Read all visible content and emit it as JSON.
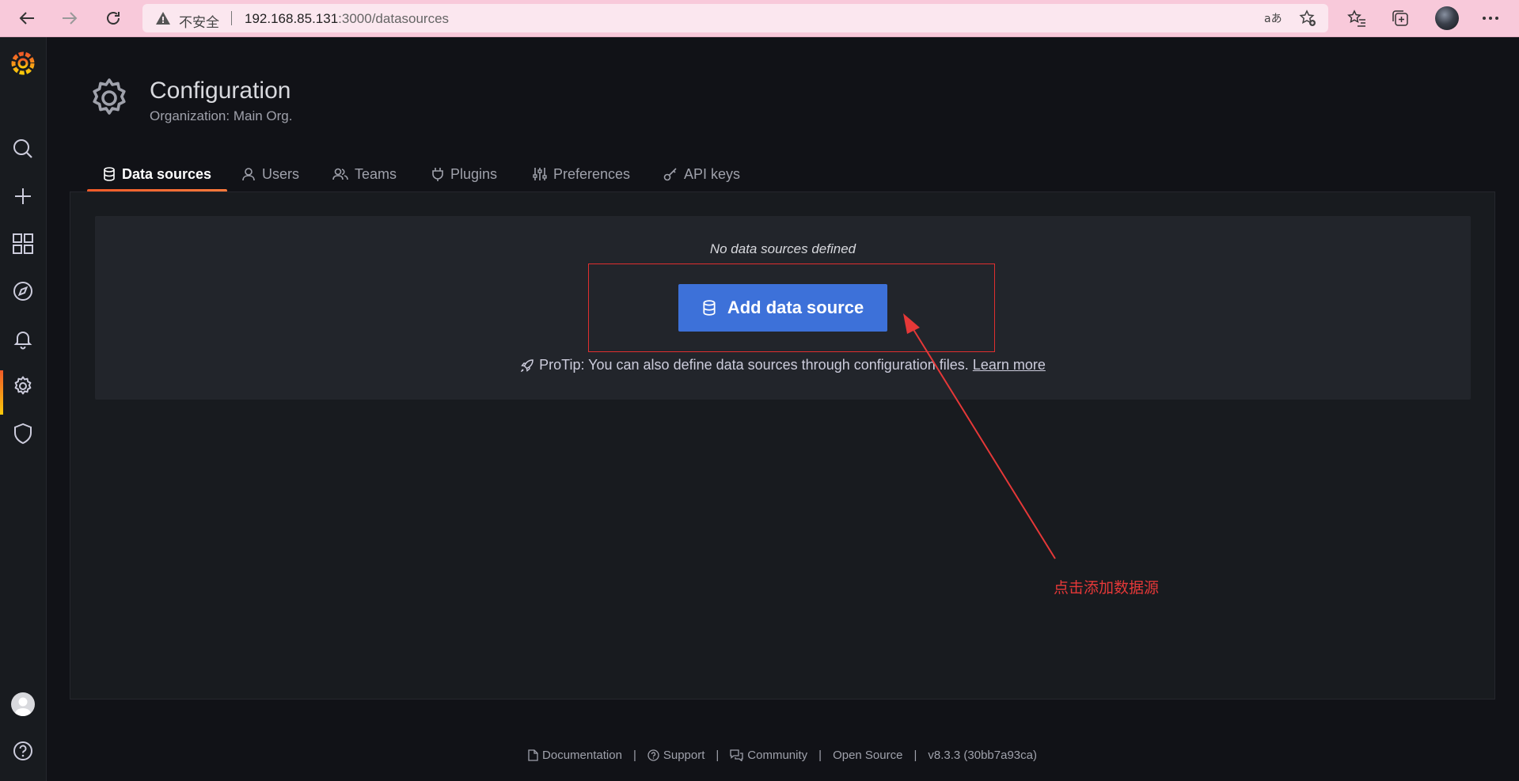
{
  "browser": {
    "insecure_label": "不安全",
    "url_host": "192.168.85.131",
    "url_rest": ":3000/datasources"
  },
  "header": {
    "title": "Configuration",
    "subtitle": "Organization: Main Org."
  },
  "tabs": [
    {
      "label": "Data sources",
      "icon": "database-icon",
      "active": true
    },
    {
      "label": "Users",
      "icon": "user-icon",
      "active": false
    },
    {
      "label": "Teams",
      "icon": "users-icon",
      "active": false
    },
    {
      "label": "Plugins",
      "icon": "plug-icon",
      "active": false
    },
    {
      "label": "Preferences",
      "icon": "sliders-icon",
      "active": false
    },
    {
      "label": "API keys",
      "icon": "key-icon",
      "active": false
    }
  ],
  "empty_state": {
    "title": "No data sources defined",
    "button_label": "Add data source",
    "protip": "ProTip: You can also define data sources through configuration files.",
    "learn_more": "Learn more"
  },
  "annotation": {
    "text": "点击添加数据源",
    "color": "#e53838"
  },
  "footer": {
    "documentation": "Documentation",
    "support": "Support",
    "community": "Community",
    "open_source": "Open Source",
    "version": "v8.3.3 (30bb7a93ca)"
  },
  "colors": {
    "accent": "#f05a28",
    "primary_button": "#3d71d9",
    "background": "#111217",
    "browser_bar": "#f8c9da"
  }
}
